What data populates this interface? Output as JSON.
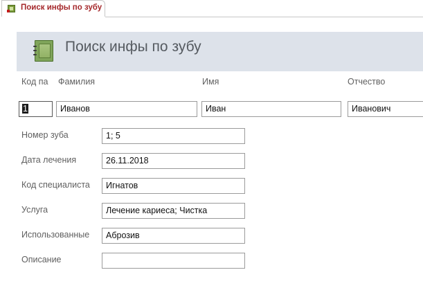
{
  "tab": {
    "label": "Поиск инфы по зубу",
    "icon": "form-icon"
  },
  "header": {
    "title": "Поиск инфы по зубу",
    "icon": "form-icon"
  },
  "columns": {
    "code": "Код па",
    "surname": "Фамилия",
    "name": "Имя",
    "patronymic": "Отчество"
  },
  "record": {
    "code": "1",
    "surname": "Иванов",
    "name": "Иван",
    "patronymic": "Иванович"
  },
  "fields": [
    {
      "label": "Номер зуба",
      "value": "1; 5"
    },
    {
      "label": "Дата лечения",
      "value": "26.11.2018"
    },
    {
      "label": "Код специалиста",
      "value": "Игнатов"
    },
    {
      "label": "Услуга",
      "value": "Лечение кариеса; Чистка"
    },
    {
      "label": "Использованные",
      "value": "Аброзив"
    },
    {
      "label": "Описание",
      "value": ""
    }
  ]
}
